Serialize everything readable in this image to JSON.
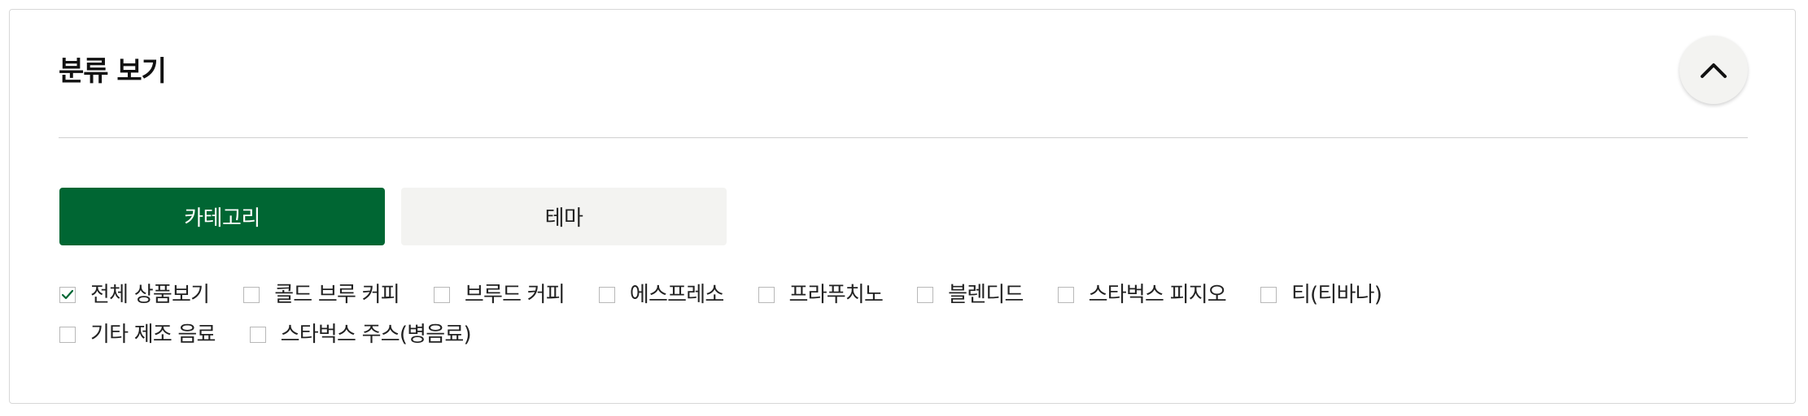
{
  "section": {
    "title": "분류 보기",
    "collapse_icon": "chevron-up-icon"
  },
  "tabs": [
    {
      "label": "카테고리",
      "active": true
    },
    {
      "label": "테마",
      "active": false
    }
  ],
  "filters": {
    "items": [
      {
        "label": "전체 상품보기",
        "checked": true
      },
      {
        "label": "콜드 브루 커피",
        "checked": false
      },
      {
        "label": "브루드 커피",
        "checked": false
      },
      {
        "label": "에스프레소",
        "checked": false
      },
      {
        "label": "프라푸치노",
        "checked": false
      },
      {
        "label": "블렌디드",
        "checked": false
      },
      {
        "label": "스타벅스 피지오",
        "checked": false
      },
      {
        "label": "티(티바나)",
        "checked": false
      },
      {
        "label": "기타 제조 음료",
        "checked": false
      },
      {
        "label": "스타벅스 주스(병음료)",
        "checked": false
      }
    ],
    "check_icon": "checkmark-icon"
  },
  "colors": {
    "accent": "#006633",
    "tab_inactive_bg": "#f3f3f1",
    "checkmark": "#006633",
    "border": "#d7d7d7"
  }
}
